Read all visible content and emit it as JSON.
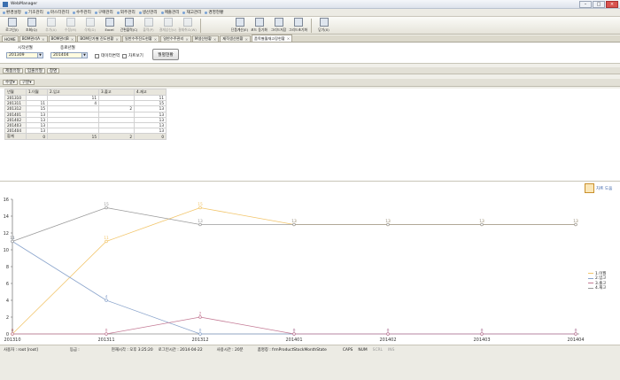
{
  "window": {
    "title": "WebManager"
  },
  "menu": [
    {
      "label": "환경설정"
    },
    {
      "label": "기초관리"
    },
    {
      "label": "마스터관리"
    },
    {
      "label": "수주관리"
    },
    {
      "label": "구매관리"
    },
    {
      "label": "외주관리"
    },
    {
      "label": "생산관리"
    },
    {
      "label": "매출관리"
    },
    {
      "label": "재고관리"
    },
    {
      "label": "경영현황"
    }
  ],
  "toolbar": {
    "left": [
      {
        "label": "로그인(I)",
        "enabled": true
      },
      {
        "label": "조회(Q)",
        "enabled": true
      },
      {
        "label": "추가(A)",
        "enabled": false
      },
      {
        "label": "수정(M)",
        "enabled": false
      },
      {
        "label": "삭제(D)",
        "enabled": false
      },
      {
        "label": "Excel",
        "enabled": true
      },
      {
        "label": "간편출력(C)",
        "enabled": true
      },
      {
        "label": "출력(P)",
        "enabled": false
      },
      {
        "label": "결재상신(V)",
        "enabled": false
      },
      {
        "label": "결재취소(W)",
        "enabled": false
      }
    ],
    "right": [
      {
        "label": "단품계산(E)"
      },
      {
        "label": "코드 동기화"
      },
      {
        "label": "그리드저장"
      },
      {
        "label": "그리드초기화"
      },
      {
        "label": "닫기(X)"
      }
    ]
  },
  "tabs": [
    {
      "label": "HOME"
    },
    {
      "label": "BOM관리A"
    },
    {
      "label": "BOM관리B"
    },
    {
      "label": "BOM단가별 진도현황"
    },
    {
      "label": "일반수주진도현황"
    },
    {
      "label": "일반수주관리"
    },
    {
      "label": "M생산현황"
    },
    {
      "label": "제작생산현황"
    },
    {
      "label": "품목별월재고장현황",
      "active": true
    }
  ],
  "filter": {
    "period_label": "시작년월",
    "period_from": "201309",
    "period_to_label": "종료년월",
    "period_to": "201404",
    "chk1": "데이터변역",
    "chk2": "차트보기",
    "search_button": "월별현황"
  },
  "group_bar": {
    "chips": [
      "제품유형",
      "입출유형",
      "창명"
    ]
  },
  "pivot_bar": {
    "chips": [
      "수량",
      "구분"
    ]
  },
  "grid": {
    "columns": [
      "년월",
      "1.이월",
      "2.입고",
      "3.출고",
      "4.재고"
    ],
    "rows": [
      [
        "201310",
        "",
        "11",
        "",
        "11"
      ],
      [
        "201311",
        "11",
        "4",
        "",
        "15"
      ],
      [
        "201312",
        "15",
        "",
        "2",
        "13"
      ],
      [
        "201401",
        "13",
        "",
        "",
        "13"
      ],
      [
        "201402",
        "13",
        "",
        "",
        "13"
      ],
      [
        "201403",
        "13",
        "",
        "",
        "13"
      ],
      [
        "201404",
        "13",
        "",
        "",
        "13"
      ]
    ],
    "total": [
      "합계",
      "0",
      "15",
      "2",
      "0"
    ]
  },
  "chart_tool": {
    "label": "차트 도움"
  },
  "chart_data": {
    "type": "line",
    "categories": [
      "201310",
      "201311",
      "201312",
      "201401",
      "201402",
      "201403",
      "201404"
    ],
    "ylim": [
      0,
      16
    ],
    "yticks": [
      0,
      2,
      4,
      6,
      8,
      10,
      12,
      14,
      16
    ],
    "series": [
      {
        "name": "1.이월",
        "color": "#f2c56a",
        "values": [
          0,
          11,
          15,
          13,
          13,
          13,
          13
        ]
      },
      {
        "name": "2.입고",
        "color": "#8aa4cc",
        "values": [
          11,
          4,
          0,
          0,
          0,
          0,
          0
        ]
      },
      {
        "name": "3.출고",
        "color": "#c47a95",
        "values": [
          0,
          0,
          2,
          0,
          0,
          0,
          0
        ]
      },
      {
        "name": "4.재고",
        "color": "#9a9a9a",
        "values": [
          11,
          15,
          13,
          13,
          13,
          13,
          13
        ]
      }
    ]
  },
  "status": {
    "user": "사용자 : root [root]",
    "dept": "등급 :",
    "now": "현재시각 : 오후 3:25:20",
    "login": "로그인시간 : 2014-04-22",
    "session": "사용시간 : 20분",
    "path": "폼명칭 : frmProductStockMonthState",
    "caps": "CAPS",
    "num": "NUM",
    "scrl": "SCRL",
    "ins": "INS"
  }
}
